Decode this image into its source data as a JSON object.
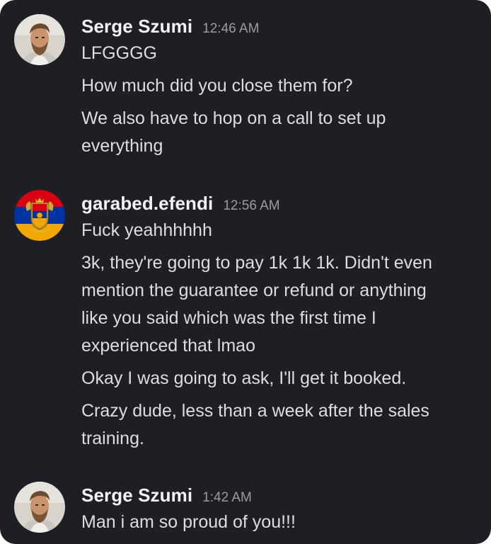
{
  "messages": [
    {
      "author": "Serge Szumi",
      "time": "12:46 AM",
      "avatar_icon": "person-avatar-icon",
      "lines": [
        "LFGGGG",
        "How much did you close them for?",
        "We also have to hop on a call to set up\neverything"
      ]
    },
    {
      "author": "garabed.efendi",
      "time": "12:56 AM",
      "avatar_icon": "armenian-coat-of-arms-avatar-icon",
      "lines": [
        "Fuck yeahhhhhh",
        "3k, they're going to pay 1k 1k 1k. Didn't even\nmention the guarantee or refund or anything\nlike you said which was the first time I\nexperienced that lmao",
        "Okay I was going to ask, I'll get it booked.",
        "Crazy dude, less than a week after the sales\ntraining."
      ]
    },
    {
      "author": "Serge Szumi",
      "time": "1:42 AM",
      "avatar_icon": "person-avatar-icon",
      "lines": [
        "Man i am so proud of you!!!"
      ]
    }
  ],
  "colors": {
    "background": "#1e1f24",
    "username": "#f2f3f5",
    "message_text": "#dcdde1",
    "timestamp": "#9a9ca3",
    "flag_red": "#d90012",
    "flag_blue": "#0033a0",
    "flag_orange": "#f2a800"
  }
}
